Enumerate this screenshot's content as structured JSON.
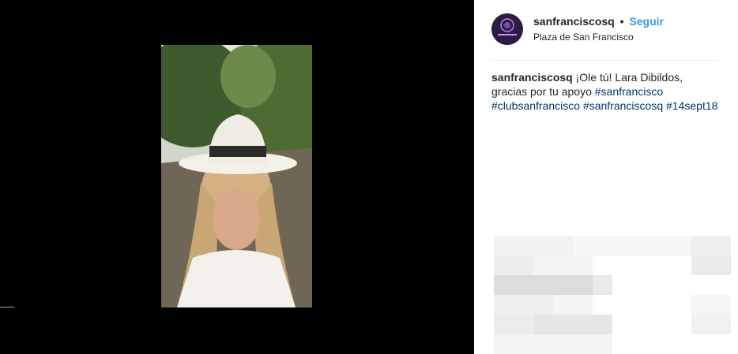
{
  "post": {
    "username": "sanfranciscosq",
    "separator": "•",
    "follow_label": "Seguir",
    "location": "Plaza de San Francisco",
    "avatar_text": "San Francisco"
  },
  "caption": {
    "author": "sanfranciscosq",
    "text": "¡Ole tú! Lara Dibildos, gracias por tu apoyo",
    "hashtags": [
      "#sanfrancisco",
      "#clubsanfrancisco",
      "#sanfranciscosq",
      "#14sept18"
    ]
  },
  "colors": {
    "follow": "#3897f0",
    "hashtag": "#003569",
    "text": "#262626"
  },
  "icons": {
    "avatar": "brand-logo-icon"
  }
}
